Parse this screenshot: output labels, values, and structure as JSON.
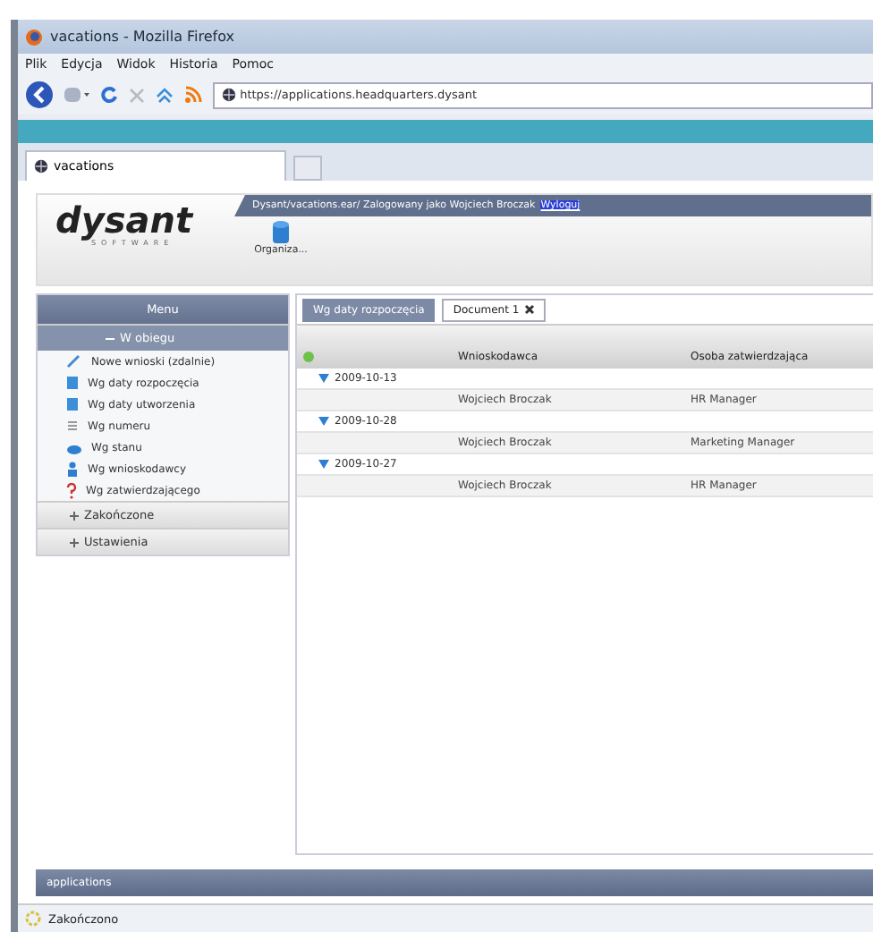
{
  "window": {
    "title": "vacations - Mozilla Firefox"
  },
  "menu_bar": [
    "Plik",
    "Edycja",
    "Widok",
    "Historia",
    "Pomoc"
  ],
  "address": "https://applications.headquarters.dysant",
  "browser_tabs": [
    {
      "label": "vacations",
      "selected": true
    }
  ],
  "app": {
    "logo": "dysant",
    "logo_sub": "SOFTWARE",
    "user_line": "Dysant/vacations.ear/ Zalogowany jako Wojciech Broczak",
    "logout": "Wyloguj",
    "toolbar_item": "Organiza..."
  },
  "menu": {
    "title": "Menu",
    "sections": [
      {
        "label": "W obiegu",
        "expanded": true,
        "items": [
          {
            "label": "Nowe wnioski (zdalnie)"
          },
          {
            "label": "Wg daty rozpoczęcia"
          },
          {
            "label": "Wg daty utworzenia"
          },
          {
            "label": "Wg numeru"
          },
          {
            "label": "Wg stanu"
          },
          {
            "label": "Wg wnioskodawcy"
          },
          {
            "label": "Wg zatwierdzającego"
          }
        ]
      },
      {
        "label": "Zakończone",
        "expanded": false
      },
      {
        "label": "Ustawienia",
        "expanded": false
      }
    ]
  },
  "content_tabs": [
    {
      "label": "Wg daty rozpoczęcia",
      "selected": false,
      "closable": false
    },
    {
      "label": "Document 1",
      "selected": true,
      "closable": true
    }
  ],
  "table": {
    "columns": [
      "Wnioskodawca",
      "Osoba zatwierdzająca"
    ],
    "rows": [
      {
        "kind": "group",
        "label": "2009-10-13",
        "expanded": true
      },
      {
        "kind": "row",
        "cells": [
          "Wojciech Broczak",
          "HR Manager"
        ]
      },
      {
        "kind": "group",
        "label": "2009-10-28",
        "expanded": true
      },
      {
        "kind": "row",
        "cells": [
          "Wojciech Broczak",
          "Marketing Manager"
        ]
      },
      {
        "kind": "group",
        "label": "2009-10-27",
        "expanded": true
      },
      {
        "kind": "row",
        "cells": [
          "Wojciech Broczak",
          "HR Manager"
        ]
      }
    ]
  },
  "footer": "applications",
  "status_bar": "Zakończono"
}
